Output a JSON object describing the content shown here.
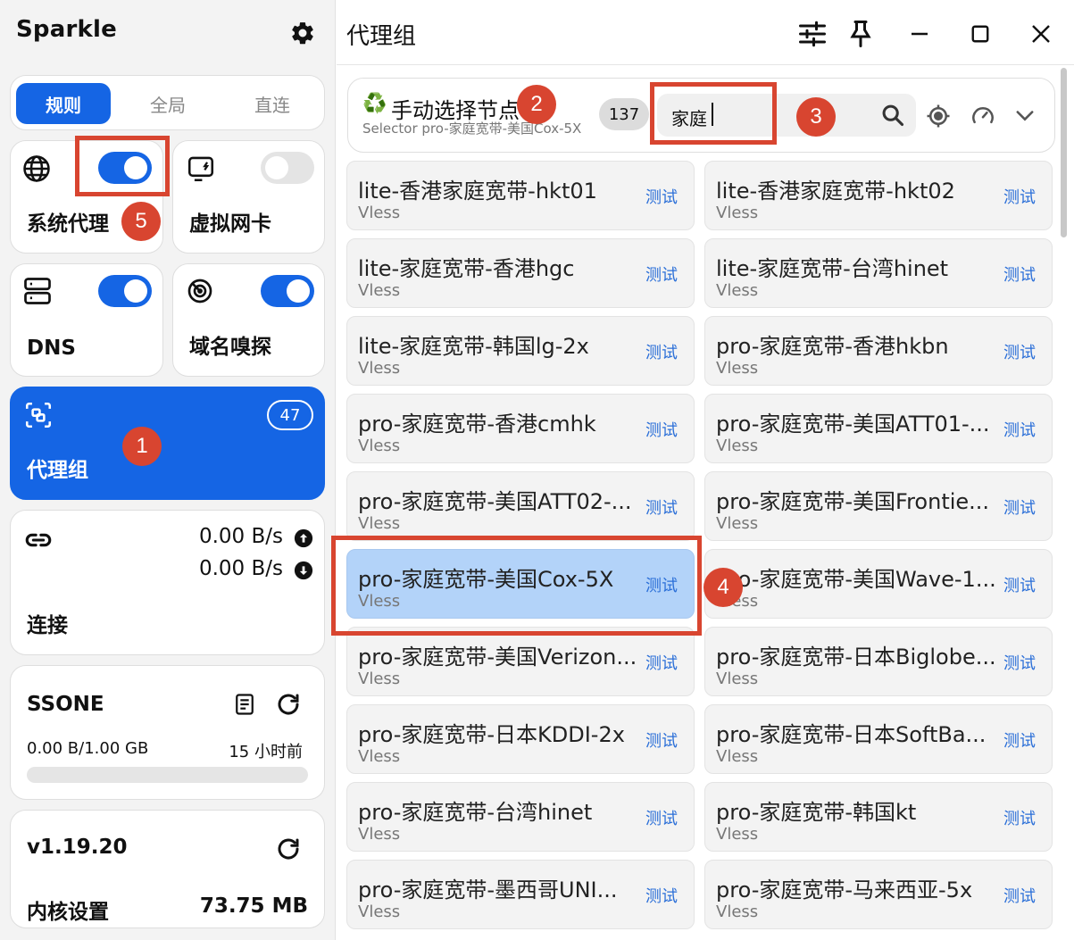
{
  "app": {
    "title": "Sparkle"
  },
  "modes": {
    "rule": "规则",
    "global": "全局",
    "direct": "直连"
  },
  "tiles": {
    "system_proxy": "系统代理",
    "tun": "虚拟网卡",
    "dns": "DNS",
    "sniff": "域名嗅探",
    "proxy_group": "代理组",
    "proxy_group_count": "47",
    "connections": "连接",
    "upload_speed": "0.00 B/s",
    "download_speed": "0.00 B/s"
  },
  "subscription": {
    "name": "SSONE",
    "usage": "0.00 B/1.00 GB",
    "updated": "15 小时前",
    "progress_fraction": 0
  },
  "core": {
    "version": "v1.19.20",
    "settings_label": "内核设置",
    "memory": "73.75 MB"
  },
  "page": {
    "title": "代理组"
  },
  "group": {
    "emoji": "♻️",
    "name": "手动选择节点",
    "subtitle": "Selector pro-家庭宽带-美国Cox-5X",
    "count": "137",
    "search_value": "家庭"
  },
  "test_label": "测试",
  "proxies": [
    {
      "name": "lite-香港家庭宽带-hkt01",
      "type": "Vless"
    },
    {
      "name": "lite-香港家庭宽带-hkt02",
      "type": "Vless"
    },
    {
      "name": "lite-家庭宽带-香港hgc",
      "type": "Vless"
    },
    {
      "name": "lite-家庭宽带-台湾hinet",
      "type": "Vless"
    },
    {
      "name": "lite-家庭宽带-韩国lg-2x",
      "type": "Vless"
    },
    {
      "name": "pro-家庭宽带-香港hkbn",
      "type": "Vless"
    },
    {
      "name": "pro-家庭宽带-香港cmhk",
      "type": "Vless"
    },
    {
      "name": "pro-家庭宽带-美国ATT01-...",
      "type": "Vless"
    },
    {
      "name": "pro-家庭宽带-美国ATT02-...",
      "type": "Vless"
    },
    {
      "name": "pro-家庭宽带-美国Frontie...",
      "type": "Vless"
    },
    {
      "name": "pro-家庭宽带-美国Cox-5X",
      "type": "Vless",
      "selected": true
    },
    {
      "name": "pro-家庭宽带-美国Wave-1...",
      "type": "Vless"
    },
    {
      "name": "pro-家庭宽带-美国Verizon...",
      "type": "Vless"
    },
    {
      "name": "pro-家庭宽带-日本Biglobe...",
      "type": "Vless"
    },
    {
      "name": "pro-家庭宽带-日本KDDI-2x",
      "type": "Vless"
    },
    {
      "name": "pro-家庭宽带-日本SoftBa...",
      "type": "Vless"
    },
    {
      "name": "pro-家庭宽带-台湾hinet",
      "type": "Vless"
    },
    {
      "name": "pro-家庭宽带-韩国kt",
      "type": "Vless"
    },
    {
      "name": "pro-家庭宽带-墨西哥UNI...",
      "type": "Vless"
    },
    {
      "name": "pro-家庭宽带-马来西亚-5x",
      "type": "Vless"
    }
  ],
  "annotations": [
    "1",
    "2",
    "3",
    "4",
    "5"
  ],
  "colors": {
    "accent": "#1565e4",
    "annotation": "#d84530",
    "selected": "#b3d3f9"
  }
}
